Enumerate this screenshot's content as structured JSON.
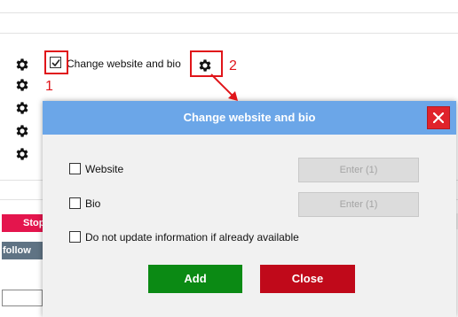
{
  "background": {
    "gear_count": 5,
    "main_checkbox_label": "Change website and bio",
    "main_checkbox_checked": true,
    "stop_label": "Stop",
    "follow_label": "follow"
  },
  "annotations": {
    "marker_1": "1",
    "marker_2": "2",
    "color": "#e0151a"
  },
  "modal": {
    "title": "Change website and bio",
    "header_color": "#6ba6e8",
    "close_icon": "close-x-icon",
    "options": [
      {
        "label": "Website",
        "checked": false,
        "button": "Enter (1)"
      },
      {
        "label": "Bio",
        "checked": false,
        "button": "Enter (1)"
      }
    ],
    "skip_label": "Do not update information if already available",
    "add_label": "Add",
    "close_label": "Close",
    "add_color": "#0b8a14",
    "close_color": "#c0091a"
  }
}
